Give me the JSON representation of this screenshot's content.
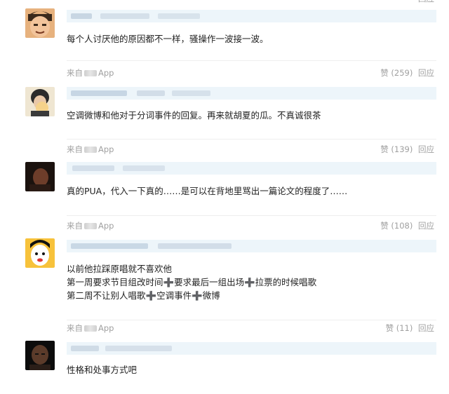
{
  "comments": [
    {
      "text_lines": [
        "每个人讨厌他的原因都不一样，骚操作一波接一波。"
      ],
      "from_label": "",
      "likes_label": "",
      "reply_label": "回应",
      "avatar_colors": [
        "#c9855a",
        "#f2c49b",
        "#3b2a1c"
      ]
    },
    {
      "text_lines": [
        "空调微博和他对于分词事件的回复。再来就胡夏的瓜。不真诚很茶"
      ],
      "from_label": "来自",
      "from_suffix": "App",
      "likes_label": "赞 (259)",
      "reply_label": "回应",
      "avatar_colors": [
        "#f5d28a",
        "#2b2b2b",
        "#e0a94a"
      ]
    },
    {
      "text_lines": [
        "真的PUA，代入一下真的……是可以在背地里骂出一篇论文的程度了……"
      ],
      "from_label": "来自",
      "from_suffix": "App",
      "likes_label": "赞 (139)",
      "reply_label": "回应",
      "avatar_colors": [
        "#3a2620",
        "#6d3d2a",
        "#1b120e"
      ]
    },
    {
      "text_lines": [
        "以前他拉踩原唱就不喜欢他",
        "第一周要求节目组改时间➕要求最后一组出场➕拉票的时候唱歌",
        "第二周不让别人唱歌➕空调事件➕微博"
      ],
      "from_label": "来自",
      "from_suffix": "App",
      "likes_label": "赞 (108)",
      "reply_label": "回应",
      "avatar_colors": [
        "#f7c23b",
        "#ffffff",
        "#111111"
      ]
    },
    {
      "text_lines": [
        "性格和处事方式吧"
      ],
      "from_label": "来自",
      "from_suffix": "App",
      "likes_label": "赞 (11)",
      "reply_label": "回应",
      "avatar_colors": [
        "#2a1e18",
        "#5b3b2a",
        "#0c0c0c"
      ]
    }
  ]
}
